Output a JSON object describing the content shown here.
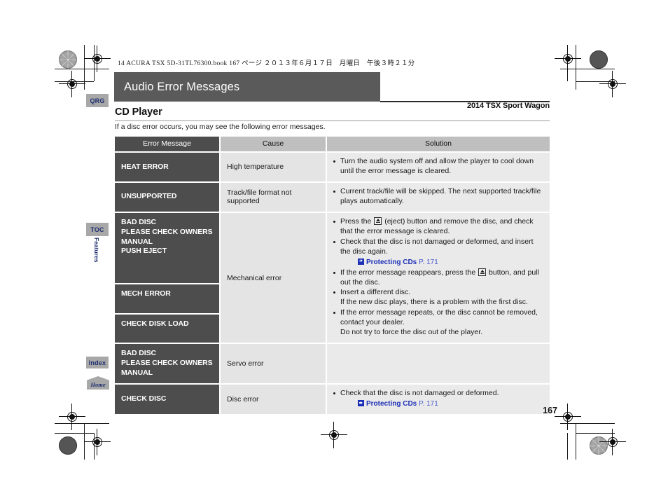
{
  "print_header": "14 ACURA TSX 5D-31TL76300.book  167 ページ  ２０１３年６月１７日　月曜日　午後３時２１分",
  "chapter": {
    "title": "Audio Error Messages"
  },
  "model_line": "2014 TSX Sport Wagon",
  "section": {
    "heading": "CD Player",
    "intro": "If a disc error occurs, you may see the following error messages."
  },
  "table": {
    "headers": {
      "error_message": "Error Message",
      "cause": "Cause",
      "solution": "Solution"
    },
    "rows": [
      {
        "messages": [
          "HEAT ERROR"
        ],
        "cause": "High temperature",
        "solution": [
          "Turn the audio system off and allow the player to cool down until the error message is cleared."
        ]
      },
      {
        "messages": [
          "UNSUPPORTED"
        ],
        "cause": "Track/file format not supported",
        "solution": [
          "Current track/file will be skipped. The next supported track/file plays automatically."
        ]
      },
      {
        "messages": [
          "BAD DISC\nPLEASE CHECK OWNERS\nMANUAL\nPUSH EJECT",
          "MECH ERROR",
          "CHECK DISK LOAD"
        ],
        "cause": "Mechanical error",
        "solution_b1_pre": "Press the ",
        "solution_b1_post": " (eject) button and remove the disc, and check that the error message is cleared.",
        "solution_b2": "Check that the disc is not damaged or deformed, and insert the disc again.",
        "xref_label": "Protecting CDs",
        "xref_page": "P. 171",
        "solution_b3_pre": "If the error message reappears, press the ",
        "solution_b3_post": " button, and pull out the disc."
      },
      {
        "messages": [
          "BAD DISC\nPLEASE CHECK OWNERS\nMANUAL"
        ],
        "cause": "Servo error",
        "solution_b1": "Insert a different disc.",
        "solution_b1_sub": "If the new disc plays, there is a problem with the first disc.",
        "solution_b2": "If the error message repeats, or the disc cannot be removed, contact your dealer.",
        "solution_b2_sub": "Do not try to force the disc out of the player."
      },
      {
        "messages": [
          "CHECK DISC"
        ],
        "cause": "Disc error",
        "solution": [
          "Check that the disc is not damaged or deformed."
        ],
        "xref_label": "Protecting CDs",
        "xref_page": "P. 171"
      }
    ]
  },
  "side_tabs": {
    "qrg": "QRG",
    "toc": "TOC",
    "features": "Features",
    "index": "Index",
    "home": "Home"
  },
  "folio": "167",
  "colors": {
    "header_bar": "#5a5a5a",
    "table_dark": "#4d4d4d",
    "table_header_light": "#bfbfbf",
    "cause_cell": "#e4e4e4",
    "solution_cell": "#eaeaea",
    "link_blue": "#1d30b8",
    "tab_gray": "#a8a8a8",
    "tab_text": "#1f3070"
  }
}
